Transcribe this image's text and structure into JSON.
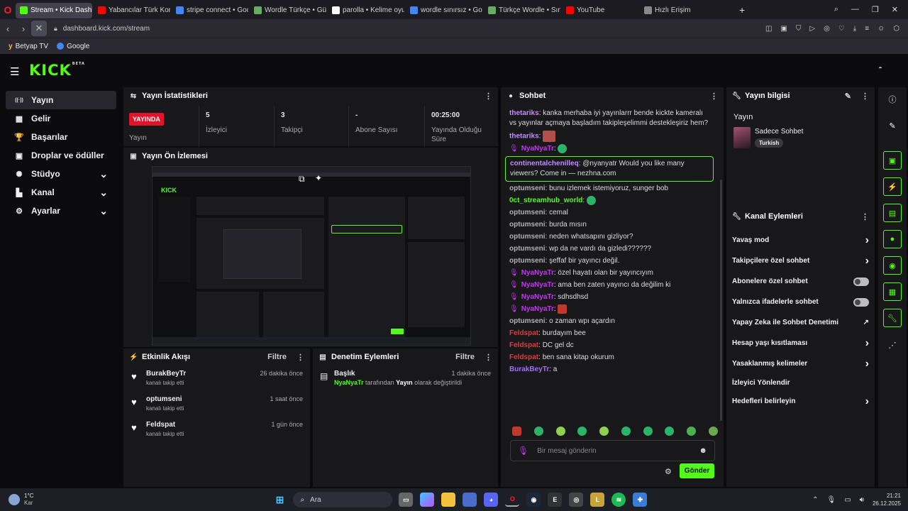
{
  "browser": {
    "tabs": [
      {
        "label": "Stream • Kick Dashbo",
        "color": "#53fc18",
        "active": true
      },
      {
        "label": "Yabancılar Türk Korku Film",
        "color": "#ff0000"
      },
      {
        "label": "stripe connect • Google'd",
        "color": "#4285f4"
      },
      {
        "label": "Wordle Türkçe • Günlük K",
        "color": "#6aaa64"
      },
      {
        "label": "parolla • Kelime oyunu. G",
        "color": "#ffffff"
      },
      {
        "label": "wordle sınırsız • Google'd",
        "color": "#4285f4"
      },
      {
        "label": "Türkçe Wordle • Sınırsız O",
        "color": "#6aaa64"
      },
      {
        "label": "YouTube",
        "color": "#ff0000"
      },
      {
        "label": "Hızlı Erişim",
        "color": "#888888"
      }
    ],
    "url": "dashboard.kick.com/stream",
    "url_bold": "kick.com",
    "bookmarks": [
      "Betyap TV",
      "Google"
    ]
  },
  "app": {
    "logo": "KICK",
    "logo_badge": "BETA",
    "sidebar": [
      {
        "label": "Yayın",
        "icon": "broadcast-icon",
        "glyph": "((·))",
        "active": true
      },
      {
        "label": "Gelir",
        "icon": "revenue-icon",
        "glyph": "▦"
      },
      {
        "label": "Başarılar",
        "icon": "trophy-icon",
        "glyph": "🏆"
      },
      {
        "label": "Droplar ve ödüller",
        "icon": "drops-icon",
        "glyph": "▣"
      },
      {
        "label": "Stüdyo",
        "icon": "studio-icon",
        "glyph": "✺",
        "chevron": true
      },
      {
        "label": "Kanal",
        "icon": "channel-icon",
        "glyph": "▙",
        "chevron": true
      },
      {
        "label": "Ayarlar",
        "icon": "settings-icon",
        "glyph": "⚙",
        "chevron": true
      }
    ],
    "stats": {
      "title": "Yayın İstatistikleri",
      "live_badge": "YAYINDA",
      "live_label": "Yayın",
      "items": [
        {
          "value": "5",
          "label": "İzleyici"
        },
        {
          "value": "3",
          "label": "Takipçi"
        },
        {
          "value": "-",
          "label": "Abone Sayısı"
        },
        {
          "value": "00:25:00",
          "label": "Yayında Olduğu Süre"
        }
      ]
    },
    "preview": {
      "title": "Yayın Ön İzlemesi"
    },
    "activity": {
      "title": "Etkinlik Akışı",
      "filter": "Filtre",
      "items": [
        {
          "user": "BurakBeyTr",
          "action": "kanalı takip etti",
          "time": "26 dakika önce"
        },
        {
          "user": "optumseni",
          "action": "kanalı takip etti",
          "time": "1 saat önce"
        },
        {
          "user": "Feldspat",
          "action": "kanalı takip etti",
          "time": "1 gün önce"
        }
      ]
    },
    "moderation": {
      "title": "Denetim Eylemleri",
      "filter": "Filtre",
      "item": {
        "title": "Başlık",
        "user": "NyaNyaTr",
        "text1": "tarafından",
        "target": "Yayın",
        "text2": "olarak değiştirildi",
        "time": "1 dakika önce"
      }
    },
    "chat": {
      "title": "Sohbet",
      "messages": [
        {
          "user": "thetariks",
          "color": "#c08cff",
          "text": "kanka merhaba iyi yayınlarrr bende kickte kameralı vs yayınlar açmaya başladım takipleşelimmi destekleşiriz hem?"
        },
        {
          "user": "thetariks",
          "color": "#c08cff",
          "text": "",
          "emote": "pic"
        },
        {
          "user": "NyaNyaTr",
          "color": "#c238f0",
          "text": "",
          "emote": "green",
          "mic": true
        },
        {
          "user": "continentalchenilleq",
          "color": "#c08cff",
          "text": "@nyanyatr Would you like many viewers? Come in — nezhna.com",
          "highlight": true
        },
        {
          "user": "optumseni",
          "color": "#b0b0b0",
          "text": "bunu izlemek istemiyoruz, sunger bob"
        },
        {
          "user": "0ct_streamhub_world",
          "color": "#53fc18",
          "text": "",
          "emote": "green"
        },
        {
          "user": "optumseni",
          "color": "#b0b0b0",
          "text": "cemal"
        },
        {
          "user": "optumseni",
          "color": "#b0b0b0",
          "text": "burda mısın"
        },
        {
          "user": "optumseni",
          "color": "#b0b0b0",
          "text": "neden whatsapını gizliyor?"
        },
        {
          "user": "optumseni",
          "color": "#b0b0b0",
          "text": "wp da ne vardı da gizledi??????"
        },
        {
          "user": "optumseni",
          "color": "#b0b0b0",
          "text": "şeffaf bir yayıncı değil."
        },
        {
          "user": "NyaNyaTr",
          "color": "#c238f0",
          "text": "özel hayatı olan bir yayıncıyım",
          "mic": true
        },
        {
          "user": "NyaNyaTr",
          "color": "#c238f0",
          "text": "ama ben zaten yayıncı da değilim ki",
          "mic": true
        },
        {
          "user": "NyaNyaTr",
          "color": "#c238f0",
          "text": "sdhsdhsd",
          "mic": true
        },
        {
          "user": "NyaNyaTr",
          "color": "#c238f0",
          "text": "",
          "emote": "red",
          "mic": true
        },
        {
          "user": "optumseni",
          "color": "#b0b0b0",
          "text": "o zaman wpı açardın"
        },
        {
          "user": "Feldspat",
          "color": "#e03a3a",
          "text": "burdayım bee"
        },
        {
          "user": "Feldspat",
          "color": "#e03a3a",
          "text": "DC gel dc"
        },
        {
          "user": "Feldspat",
          "color": "#e03a3a",
          "text": "ben sana kitap okurum"
        },
        {
          "user": "BurakBeyTr",
          "color": "#a36bff",
          "text": "a"
        }
      ],
      "input_placeholder": "Bir mesaj gönderin",
      "send": "Gönder"
    },
    "stream_info": {
      "title": "Yayın bilgisi",
      "subtitle": "Yayın",
      "category": "Sadece Sohbet",
      "tag": "Turkish"
    },
    "channel_actions": {
      "title": "Kanal Eylemleri",
      "items": [
        {
          "label": "Yavaş mod",
          "end": "chevron"
        },
        {
          "label": "Takipçilere özel sohbet",
          "end": "chevron"
        },
        {
          "label": "Abonelere özel sohbet",
          "end": "toggle"
        },
        {
          "label": "Yalnızca ifadelerle sohbet",
          "end": "toggle"
        },
        {
          "label": "Yapay Zeka ile Sohbet Denetimi",
          "end": "external"
        },
        {
          "label": "Hesap yaşı kısıtlaması",
          "end": "chevron"
        },
        {
          "label": "Yasaklanmış kelimeler",
          "end": "chevron"
        },
        {
          "label": "İzleyici Yönlendir",
          "end": "none"
        },
        {
          "label": "Hedefleri belirleyin",
          "end": "chevron"
        }
      ]
    }
  },
  "taskbar": {
    "weather_temp": "1°C",
    "weather_text": "Kar",
    "search_label": "Ara",
    "time": "21:21",
    "date": "26.12.2025"
  }
}
